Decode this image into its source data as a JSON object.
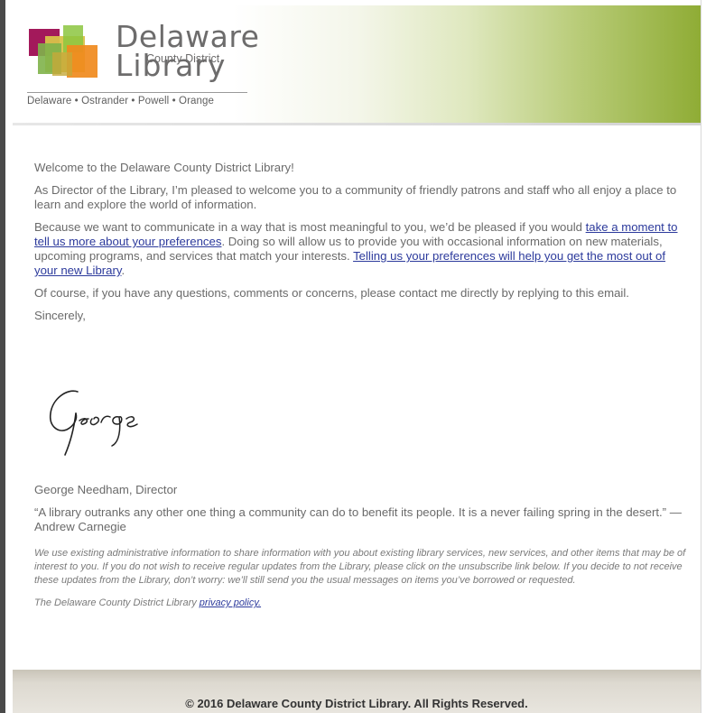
{
  "header": {
    "logo_word_1": "Delaware",
    "logo_word_2": "Library",
    "logo_small": "County District",
    "branches": "Delaware • Ostrander • Powell • Orange"
  },
  "body": {
    "greeting": "Welcome to the Delaware County District Library!",
    "paragraph_1": "As Director of the Library, I’m pleased to welcome you to a community of friendly patrons and staff who all enjoy a place to learn and explore the world of information.",
    "paragraph_2_prefix": "Because we want to communicate in a way that is most meaningful to you, we’d be pleased if you would ",
    "paragraph_2_link_1": "take a moment to tell us more about your preferences",
    "paragraph_2_middle": ". Doing so will allow us to provide you with occasional information on new materials, upcoming programs, and services that match your interests. ",
    "paragraph_2_link_2": "Telling us your preferences will help you get the most out of your new Library",
    "paragraph_2_suffix": ".",
    "paragraph_3": "Of course, if you have any questions, comments or concerns, please contact me directly by replying to this email.",
    "closing": "Sincerely,",
    "signature": "George",
    "signer": "George Needham, Director",
    "quote": "“A library outranks any other one thing a community can do to benefit its people. It is a never failing spring in the desert.” — Andrew Carnegie"
  },
  "fine_print": {
    "notice": "We use existing administrative information to share information with you about existing library services, new services, and other items that may be of interest to you. If you do not wish to receive regular updates from the Library, please click on the unsubscribe link below. If you decide to not receive these updates from the Library, don’t worry: we’ll still send you the usual messages on items you’ve borrowed or requested.",
    "policy_prefix": "The Delaware County District Library ",
    "policy_link": "privacy policy."
  },
  "footer": {
    "copyright": "© 2016 Delaware County District Library. All Rights Reserved."
  },
  "colors": {
    "header_green": "#8fac35",
    "link": "#2c3a9c",
    "text": "#6a6a6a"
  }
}
